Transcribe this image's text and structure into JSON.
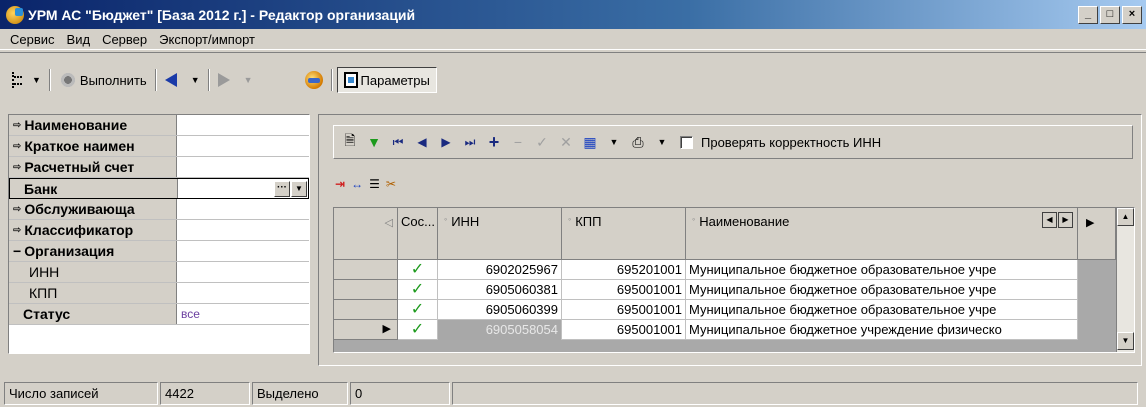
{
  "window": {
    "title": "УРМ АС \"Бюджет\" [База 2012 г.] - Редактор организаций",
    "controls": [
      "_",
      "□",
      "×"
    ]
  },
  "menu": [
    "Сервис",
    "Вид",
    "Сервер",
    "Экспорт/импорт"
  ],
  "toolbar": {
    "execute_label": "Выполнить",
    "params_label": "Параметры"
  },
  "filter": {
    "rows": [
      {
        "caption": "Наименование",
        "value": "",
        "marker": "⇨"
      },
      {
        "caption": "Краткое наимен",
        "value": "",
        "marker": "⇨"
      },
      {
        "caption": "Расчетный счет",
        "value": "",
        "marker": "⇨"
      },
      {
        "caption": "Банк",
        "value": "",
        "marker": ""
      },
      {
        "caption": "Обслуживающа",
        "value": "",
        "marker": "⇨"
      },
      {
        "caption": "Классификатор",
        "value": "",
        "marker": "⇨"
      },
      {
        "caption": "Организация",
        "value": "",
        "marker": "−"
      },
      {
        "caption": "ИНН",
        "value": "",
        "marker": ""
      },
      {
        "caption": "КПП",
        "value": "",
        "marker": ""
      },
      {
        "caption": "Статус",
        "value": "все",
        "marker": ""
      }
    ],
    "ellipsis": "···"
  },
  "grid_toolbar": {
    "check_inn_label": "Проверять корректность ИНН",
    "check_inn_checked": false
  },
  "grid": {
    "columns": [
      "Сос...",
      "ИНН",
      "КПП",
      "Наименование"
    ],
    "rows": [
      {
        "status": "✓",
        "inn": "6902025967",
        "kpp": "695201001",
        "name": "Муниципальное бюджетное образовательное учре"
      },
      {
        "status": "✓",
        "inn": "6905060381",
        "kpp": "695001001",
        "name": "Муниципальное бюджетное образовательное учре"
      },
      {
        "status": "✓",
        "inn": "6905060399",
        "kpp": "695001001",
        "name": "Муниципальное бюджетное образовательное учре"
      },
      {
        "status": "✓",
        "inn": "6905058054",
        "kpp": "695001001",
        "name": "Муниципальное бюджетное учреждение физическо"
      }
    ]
  },
  "status": {
    "records_label": "Число записей",
    "records_value": "4422",
    "selected_label": "Выделено",
    "selected_value": "0"
  }
}
